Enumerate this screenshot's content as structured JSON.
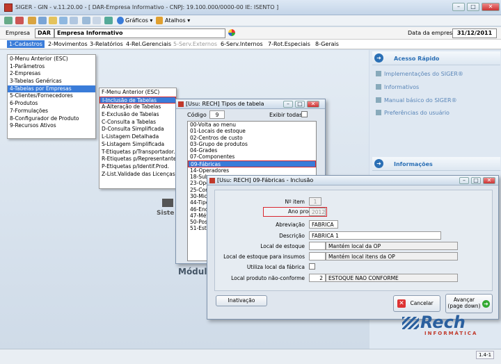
{
  "window": {
    "title": "SIGER - GIN - v.11.20.00 - [ DAR-Empresa Informativo - CNPJ: 19.100.000/0000-00 IE: ISENTO ]",
    "minimize": "–",
    "restore": "□",
    "close": "✕"
  },
  "toolbar": {
    "graficos": "Gráficos ▾",
    "atalhos": "Atalhos ▾"
  },
  "empresa": {
    "label": "Empresa",
    "code": "DAR",
    "name": "Empresa Informativo",
    "data_label": "Data da empresa",
    "date": "31/12/2011"
  },
  "menubar": [
    "1-Cadastros",
    "2-Movimentos",
    "3-Relatórios",
    "4-Rel.Gerenciais",
    "5-Serv.Externos",
    "6-Serv.Internos",
    "7-Rot.Especiais",
    "8-Gerais"
  ],
  "cadastros_menu": [
    "0-Menu Anterior (ESC)",
    "1-Parâmetros",
    "2-Empresas",
    "3-Tabelas Genéricas",
    "4-Tabelas por Empresas",
    "5-Clientes/Fornecedores",
    "6-Produtos",
    "7-Formulações",
    "8-Configurador de Produto",
    "9-Recursos Ativos"
  ],
  "tabelas_menu": [
    "F-Menu Anterior (ESC)",
    "I-Inclusão de Tabelas",
    "A-Alteração de Tabelas",
    "E-Exclusão de Tabelas",
    "C-Consulta a Tabelas",
    "D-Consulta Simplificada",
    "L-Listagem Detalhada",
    "S-Listagem Simplificada",
    "T-Etiquetas p/Transportador.",
    "R-Etiquetas p/Representantes",
    "P-Etiquetas p/Identif.Prod.",
    "Z-List.Validade das Licenças"
  ],
  "right_panel": {
    "acesso_title": "Acesso Rápido",
    "links": [
      "Implementações do SIGER®",
      "Informativos",
      "Manual básico do SIGER®",
      "Preferências do usuário"
    ],
    "info_title": "Informações"
  },
  "background": {
    "sistema": "Siste",
    "modulo": "Módul"
  },
  "tipos_window": {
    "title": "[Usu: RECH] Tipos de tabela",
    "codigo_label": "Código",
    "codigo_value": "9",
    "exibir_label": "Exibir todas",
    "items": [
      "00-Volta ao menu",
      "01-Locais de estoque",
      "02-Centros de custo",
      "03-Grupo de produtos",
      "04-Grades",
      "07-Componentes",
      "09-Fábricas",
      "14-Operadores",
      "18-Sub",
      "23-Ope",
      "25-Con",
      "30-Mic",
      "44-Tipo",
      "46-End",
      "47-Mét",
      "50-Pos",
      "51-Estr"
    ]
  },
  "fabricas_window": {
    "title": "[Usu: RECH] 09-Fábricas - Inclusão",
    "fields": {
      "item_label": "Nº item",
      "item_value": "1",
      "ano_label": "Ano produção",
      "ano_value": "2012",
      "abrev_label": "Abreviação",
      "abrev_value": "FABRICA",
      "desc_label": "Descrição",
      "desc_value": "FABRICA 1",
      "local_label": "Local de estoque",
      "local_value": "Mantém local da OP",
      "insumos_label": "Local de estoque para insumos",
      "insumos_value": "Mantém local itens da OP",
      "utiliza_label": "Utiliza local da fábrica",
      "naoconf_label": "Local produto não-conforme",
      "naoconf_code": "2",
      "naoconf_value": "ESTOQUE NAO CONFORME"
    },
    "inativacao": "Inativação",
    "cancelar": "Cancelar",
    "avancar": "Avançar",
    "avancar_sub": "(page down)"
  },
  "logo": {
    "brand": "Rech",
    "sub": "INFORMÁTICA"
  },
  "status": {
    "version": "1.4-1"
  },
  "colors": {
    "accent": "#3a7cd9",
    "highlight_red": "#d9262e",
    "link": "#5a86b8"
  }
}
